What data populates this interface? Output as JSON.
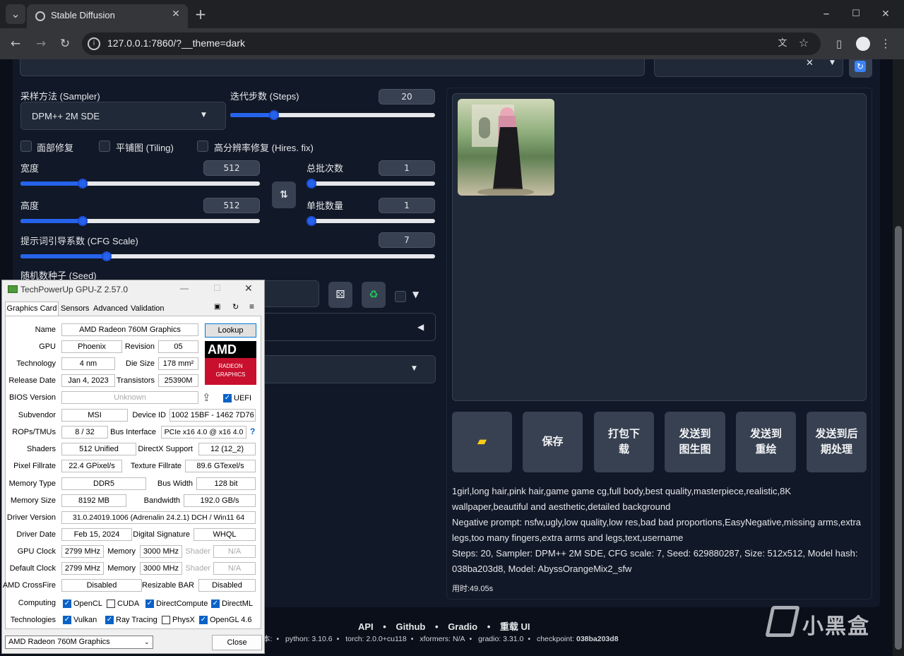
{
  "browser": {
    "tab_title": "Stable Diffusion",
    "url": "127.0.0.1:7860/?__theme=dark"
  },
  "sampler": {
    "label": "采样方法 (Sampler)",
    "value": "DPM++ 2M SDE"
  },
  "steps": {
    "label": "迭代步数 (Steps)",
    "value": "20",
    "level": 0.2
  },
  "checks": {
    "face": "面部修复",
    "tiling": "平铺图 (Tiling)",
    "hires": "高分辨率修复 (Hires. fix)"
  },
  "width": {
    "label": "宽度",
    "value": "512",
    "level": 0.25
  },
  "height": {
    "label": "高度",
    "value": "512",
    "level": 0.25
  },
  "batch_count": {
    "label": "总批次数",
    "value": "1",
    "level": 0.0
  },
  "batch_size": {
    "label": "单批数量",
    "value": "1",
    "level": 0.0
  },
  "cfg": {
    "label": "提示词引导系数 (CFG Scale)",
    "value": "7",
    "level": 0.2
  },
  "seed": {
    "label": "随机数种子 (Seed)"
  },
  "buttons": {
    "folder_icon": "folder-icon",
    "save": "保存",
    "zip": "打包下载",
    "to_img2img": "发送到图生图",
    "to_inpaint": "发送到重绘",
    "to_extras": "发送到后期处理"
  },
  "gen_info": {
    "prompt": "1girl,long hair,pink hair,game game cg,full body,best quality,masterpiece,realistic,8K wallpaper,beautiful and aesthetic,detailed background",
    "negative": "Negative prompt: nsfw,ugly,low quality,low res,bad bad proportions,EasyNegative,missing arms,extra legs,too many fingers,extra arms and legs,text,username",
    "params": "Steps: 20, Sampler: DPM++ 2M SDE, CFG scale: 7, Seed: 629880287, Size: 512x512, Model hash: 038ba203d8, Model: AbyssOrangeMix2_sfw",
    "time": "用时:49.05s"
  },
  "footer": {
    "links": [
      "API",
      "Github",
      "Gradio",
      "重载 UI"
    ],
    "version_prefix": "本:",
    "python": "python: 3.10.6",
    "torch": "torch: 2.0.0+cu118",
    "xformers": "xformers: N/A",
    "gradio": "gradio: 3.31.0",
    "checkpoint_label": "checkpoint:",
    "checkpoint": "038ba203d8"
  },
  "watermark": "小黑盒",
  "gpuz": {
    "title": "TechPowerUp GPU-Z 2.57.0",
    "tabs": [
      "Graphics Card",
      "Sensors",
      "Advanced",
      "Validation"
    ],
    "lookup": "Lookup",
    "labels": {
      "name": "Name",
      "gpu": "GPU",
      "revision": "Revision",
      "technology": "Technology",
      "die_size": "Die Size",
      "release": "Release Date",
      "transistors": "Transistors",
      "bios": "BIOS Version",
      "uefi": "UEFI",
      "subvendor": "Subvendor",
      "device_id": "Device ID",
      "rops": "ROPs/TMUs",
      "bus": "Bus Interface",
      "shaders": "Shaders",
      "directx": "DirectX Support",
      "pixel": "Pixel Fillrate",
      "texture": "Texture Fillrate",
      "memtype": "Memory Type",
      "buswidth": "Bus Width",
      "memsize": "Memory Size",
      "bandwidth": "Bandwidth",
      "driver": "Driver Version",
      "driverdate": "Driver Date",
      "digsig": "Digital Signature",
      "gpuclock": "GPU Clock",
      "memory": "Memory",
      "shader": "Shader",
      "defclock": "Default Clock",
      "crossfire": "AMD CrossFire",
      "rebar": "Resizable BAR",
      "computing": "Computing",
      "technologies": "Technologies"
    },
    "values": {
      "name": "AMD Radeon 760M Graphics",
      "gpu": "Phoenix",
      "revision": "05",
      "technology": "4 nm",
      "die_size": "178 mm²",
      "release": "Jan 4, 2023",
      "transistors": "25390M",
      "bios": "Unknown",
      "subvendor": "MSI",
      "device_id": "1002 15BF - 1462 7D76",
      "rops": "8 / 32",
      "bus": "PCIe x16 4.0 @ x16 4.0",
      "shaders": "512 Unified",
      "directx": "12 (12_2)",
      "pixel": "22.4 GPixel/s",
      "texture": "89.6 GTexel/s",
      "memtype": "DDR5",
      "buswidth": "128 bit",
      "memsize": "8192 MB",
      "bandwidth": "192.0 GB/s",
      "driver": "31.0.24019.1006 (Adrenalin 24.2.1) DCH / Win11 64",
      "driverdate": "Feb 15, 2024",
      "digsig": "WHQL",
      "gpuclock": "2799 MHz",
      "memclock": "3000 MHz",
      "shaderclock": "N/A",
      "defclock": "2799 MHz",
      "defmem": "3000 MHz",
      "defshader": "N/A",
      "crossfire": "Disabled",
      "rebar": "Disabled"
    },
    "computing": [
      "OpenCL",
      "CUDA",
      "DirectCompute",
      "DirectML"
    ],
    "technologies": [
      "Vulkan",
      "Ray Tracing",
      "PhysX",
      "OpenGL 4.6"
    ],
    "device_select": "AMD Radeon 760M Graphics",
    "close": "Close",
    "logo_text": "AMD",
    "logo_sub": "RADEON GRAPHICS"
  }
}
